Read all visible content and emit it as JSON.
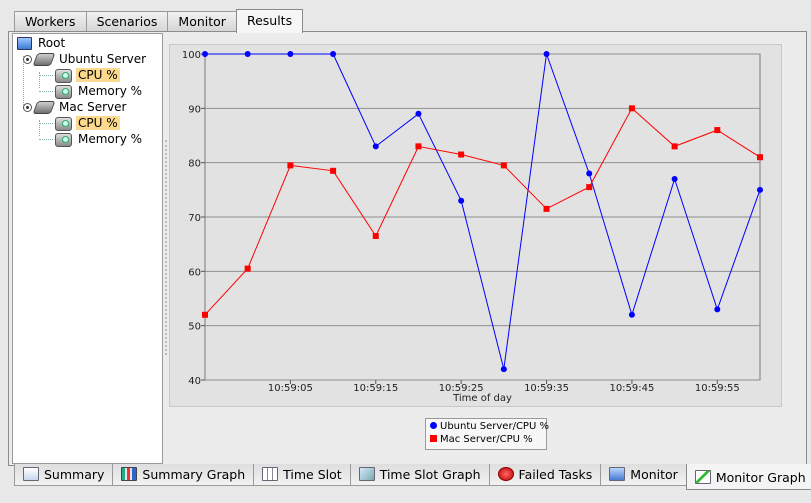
{
  "top_tabs": [
    {
      "label": "Workers"
    },
    {
      "label": "Scenarios"
    },
    {
      "label": "Monitor"
    },
    {
      "label": "Results",
      "active": true
    }
  ],
  "tree": {
    "root": {
      "label": "Root",
      "icon": "computer-icon"
    },
    "servers": [
      {
        "label": "Ubuntu Server",
        "icon": "server-icon",
        "children": [
          {
            "label": "CPU %",
            "selected": true,
            "icon": "gauge-icon"
          },
          {
            "label": "Memory %",
            "icon": "gauge-icon"
          }
        ]
      },
      {
        "label": "Mac Server",
        "icon": "server-icon",
        "children": [
          {
            "label": "CPU %",
            "selected": true,
            "icon": "gauge-icon"
          },
          {
            "label": "Memory %",
            "icon": "gauge-icon"
          }
        ]
      }
    ]
  },
  "chart_data": {
    "type": "line",
    "title": "",
    "xlabel": "Time of day",
    "ylabel": "",
    "ylim": [
      40,
      100
    ],
    "yticks": [
      "40",
      "50",
      "60",
      "70",
      "80",
      "90",
      "100"
    ],
    "xticks": [
      "10:59:05",
      "10:59:15",
      "10:59:25",
      "10:59:35",
      "10:59:45",
      "10:59:55"
    ],
    "x": [
      "10:58:55",
      "10:59:00",
      "10:59:05",
      "10:59:10",
      "10:59:15",
      "10:59:20",
      "10:59:25",
      "10:59:30",
      "10:59:35",
      "10:59:40",
      "10:59:45",
      "10:59:50",
      "10:59:55",
      "11:00:00"
    ],
    "grid": true,
    "legend_position": "bottom",
    "series": [
      {
        "name": "Ubuntu Server/CPU %",
        "color": "#0000ff",
        "marker": "circle",
        "values": [
          100,
          100,
          100,
          100,
          83,
          89,
          73,
          42,
          100,
          78,
          52,
          77,
          53,
          75
        ]
      },
      {
        "name": "Mac Server/CPU %",
        "color": "#ff0000",
        "marker": "square",
        "values": [
          52,
          60.5,
          79.5,
          78.5,
          66.5,
          83,
          81.5,
          79.5,
          71.5,
          75.5,
          90,
          83,
          86,
          81
        ]
      }
    ]
  },
  "bottom_tabs": [
    {
      "label": "Summary",
      "icon": "summary-icon"
    },
    {
      "label": "Summary Graph",
      "icon": "bar-graph-icon"
    },
    {
      "label": "Time Slot",
      "icon": "table-icon"
    },
    {
      "label": "Time Slot Graph",
      "icon": "line-graph-icon"
    },
    {
      "label": "Failed Tasks",
      "icon": "failed-icon"
    },
    {
      "label": "Monitor",
      "icon": "monitor-icon"
    },
    {
      "label": "Monitor Graph",
      "icon": "monitor-graph-icon",
      "active": true
    }
  ]
}
